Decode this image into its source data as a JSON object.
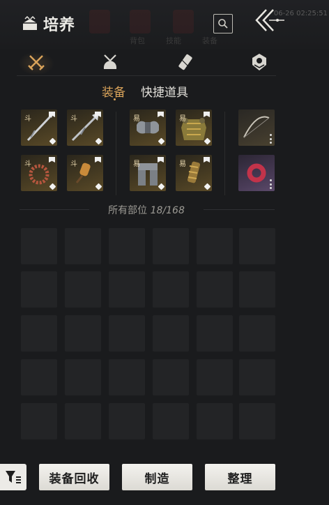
{
  "header": {
    "title": "培养",
    "timestamp": "06-26 02:25:51",
    "title_icon": "chest-icon",
    "search_icon": "search-icon",
    "back_icon": "double-chevron-left-icon",
    "ghost_labels": [
      "背包",
      "技能",
      "装备"
    ]
  },
  "categories": [
    {
      "name": "weapons",
      "icon": "crossed-swords-icon",
      "active": true
    },
    {
      "name": "consumables",
      "icon": "pouch-icon",
      "active": false
    },
    {
      "name": "scrolls",
      "icon": "scroll-icon",
      "active": false
    },
    {
      "name": "materials",
      "icon": "gem-icon",
      "active": false
    }
  ],
  "subtabs": {
    "equipment": "装备",
    "quick_items": "快捷道具"
  },
  "equipped": [
    {
      "grade": "斗",
      "item": "long-spear",
      "rarity": "gold",
      "has_marks": true
    },
    {
      "grade": "斗",
      "item": "polearm",
      "rarity": "gold",
      "has_marks": true
    },
    {
      "grade": "易",
      "item": "shoulder-armor",
      "rarity": "gold",
      "has_marks": true
    },
    {
      "grade": "易",
      "item": "chest-armor",
      "rarity": "gold",
      "has_marks": true
    },
    {
      "grade": "",
      "item": "bow",
      "rarity": "plain",
      "has_marks": false
    },
    {
      "grade": "斗",
      "item": "prayer-beads",
      "rarity": "gold",
      "has_marks": true
    },
    {
      "grade": "斗",
      "item": "gourd",
      "rarity": "gold",
      "has_marks": true
    },
    {
      "grade": "易",
      "item": "leg-armor",
      "rarity": "gold",
      "has_marks": true
    },
    {
      "grade": "易",
      "item": "bracers",
      "rarity": "gold",
      "has_marks": true
    },
    {
      "grade": "",
      "item": "red-ring",
      "rarity": "purple",
      "has_marks": false
    }
  ],
  "inventory": {
    "label": "所有部位",
    "count": "18/168"
  },
  "bottom_bar": {
    "filter_icon": "filter-icon",
    "recycle": "装备回收",
    "craft": "制造",
    "sort": "整理"
  },
  "colors": {
    "background": "#1a1b1d",
    "accent": "#d9a35a",
    "button": "#ecebe7"
  }
}
